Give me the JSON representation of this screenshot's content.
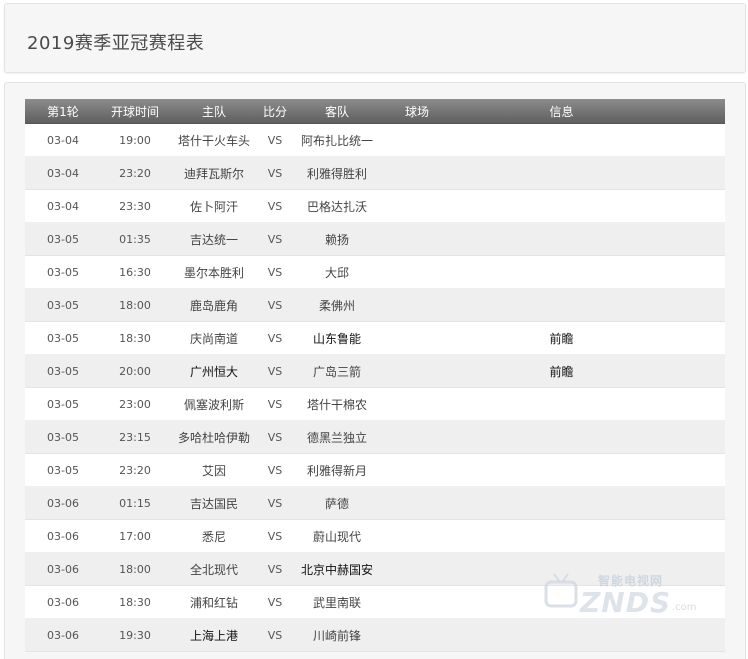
{
  "page": {
    "title": "2019赛季亚冠赛程表"
  },
  "table": {
    "headers": {
      "round": "第1轮",
      "time": "开球时间",
      "home": "主队",
      "score": "比分",
      "away": "客队",
      "venue": "球场",
      "info": "信息"
    },
    "rows": [
      {
        "date": "03-04",
        "time": "19:00",
        "home": "塔什干火车头",
        "vs": "VS",
        "away": "阿布扎比统一",
        "info": ""
      },
      {
        "date": "03-04",
        "time": "23:20",
        "home": "迪拜瓦斯尔",
        "vs": "VS",
        "away": "利雅得胜利",
        "info": ""
      },
      {
        "date": "03-04",
        "time": "23:30",
        "home": "佐卜阿汗",
        "vs": "VS",
        "away": "巴格达扎沃",
        "info": ""
      },
      {
        "date": "03-05",
        "time": "01:35",
        "home": "吉达统一",
        "vs": "VS",
        "away": "赖扬",
        "info": ""
      },
      {
        "date": "03-05",
        "time": "16:30",
        "home": "墨尔本胜利",
        "vs": "VS",
        "away": "大邱",
        "info": ""
      },
      {
        "date": "03-05",
        "time": "18:00",
        "home": "鹿岛鹿角",
        "vs": "VS",
        "away": "柔佛州",
        "info": ""
      },
      {
        "date": "03-05",
        "time": "18:30",
        "home": "庆尚南道",
        "vs": "VS",
        "away": "山东鲁能",
        "info": "前瞻"
      },
      {
        "date": "03-05",
        "time": "20:00",
        "home": "广州恒大",
        "vs": "VS",
        "away": "广岛三箭",
        "info": "前瞻"
      },
      {
        "date": "03-05",
        "time": "23:00",
        "home": "佩塞波利斯",
        "vs": "VS",
        "away": "塔什干棉农",
        "info": ""
      },
      {
        "date": "03-05",
        "time": "23:15",
        "home": "多哈杜哈伊勒",
        "vs": "VS",
        "away": "德黑兰独立",
        "info": ""
      },
      {
        "date": "03-05",
        "time": "23:20",
        "home": "艾因",
        "vs": "VS",
        "away": "利雅得新月",
        "info": ""
      },
      {
        "date": "03-06",
        "time": "01:15",
        "home": "吉达国民",
        "vs": "VS",
        "away": "萨德",
        "info": ""
      },
      {
        "date": "03-06",
        "time": "17:00",
        "home": "悉尼",
        "vs": "VS",
        "away": "蔚山现代",
        "info": ""
      },
      {
        "date": "03-06",
        "time": "18:00",
        "home": "全北现代",
        "vs": "VS",
        "away": "北京中赫国安",
        "info": ""
      },
      {
        "date": "03-06",
        "time": "18:30",
        "home": "浦和红钻",
        "vs": "VS",
        "away": "武里南联",
        "info": ""
      },
      {
        "date": "03-06",
        "time": "19:30",
        "home": "上海上港",
        "vs": "VS",
        "away": "川崎前锋",
        "info": ""
      }
    ]
  },
  "watermark": {
    "cn": "智能电视网",
    "en": "ZNDS",
    "suffix": ".com"
  }
}
